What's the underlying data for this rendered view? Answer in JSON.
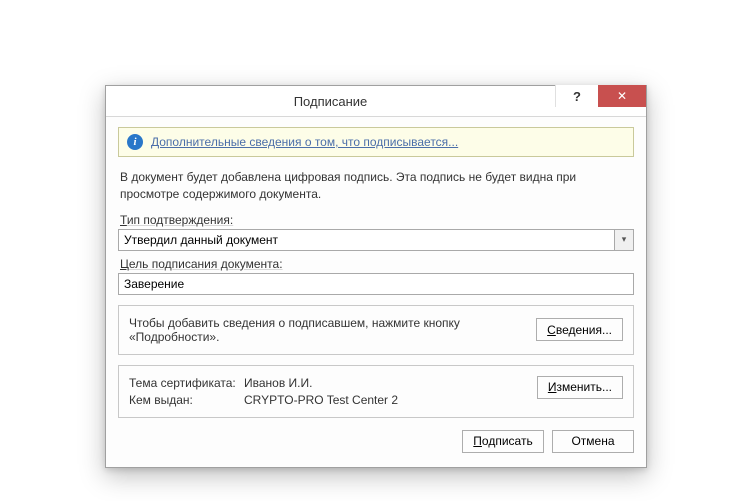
{
  "titlebar": {
    "title": "Подписание",
    "help": "?",
    "close": "✕"
  },
  "banner": {
    "icon_glyph": "i",
    "link_text": "Дополнительные сведения о том, что подписывается..."
  },
  "description": "В документ будет добавлена цифровая подпись. Эта подпись не будет видна при просмотре содержимого документа.",
  "confirm_type": {
    "label_prefix": "Т",
    "label_rest": "ип подтверждения:",
    "value": "Утвердил данный документ"
  },
  "purpose": {
    "label_prefix": "Ц",
    "label_rest": "ель подписания документа:",
    "value": "Заверение"
  },
  "details_panel": {
    "text": "Чтобы добавить сведения о подписавшем, нажмите кнопку «Подробности».",
    "button_prefix": "С",
    "button_rest": "ведения..."
  },
  "certificate": {
    "subject_label": "Тема сертификата:",
    "subject_value": "Иванов И.И.",
    "issuer_label": "Кем выдан:",
    "issuer_value": "CRYPTO-PRO Test Center 2",
    "change_prefix": "И",
    "change_rest": "зменить..."
  },
  "footer": {
    "sign_prefix": "П",
    "sign_rest": "одписать",
    "cancel": "Отмена"
  }
}
